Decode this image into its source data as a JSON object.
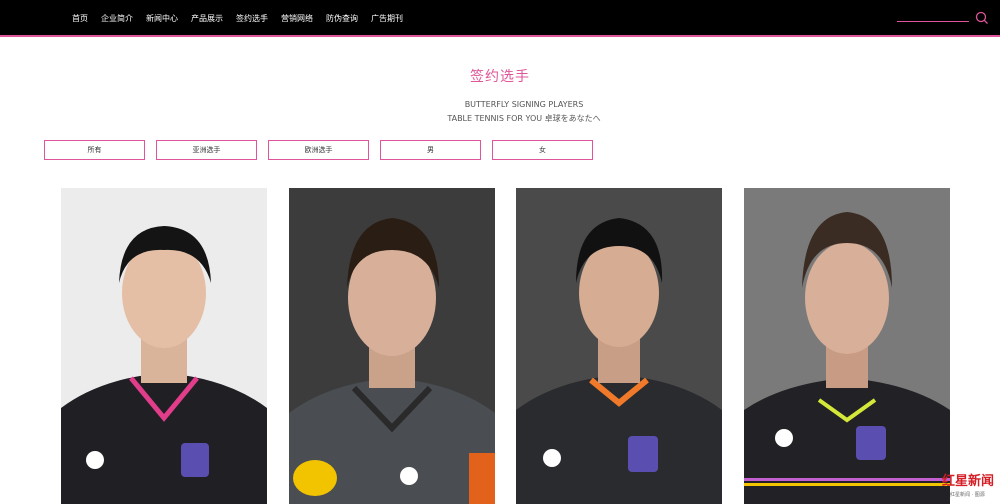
{
  "nav": {
    "items": [
      "首页",
      "企业简介",
      "新闻中心",
      "产品展示",
      "签约选手",
      "营销网络",
      "防伪查询",
      "广告期刊"
    ]
  },
  "search": {
    "icon": "search-icon"
  },
  "heading": {
    "title": "签约选手",
    "subtitle_line1": "BUTTERFLY SIGNING PLAYERS",
    "subtitle_line2": "TABLE TENNIS FOR YOU 卓球をあなたへ"
  },
  "filters": [
    "所有",
    "亚洲选手",
    "欧洲选手",
    "男",
    "女"
  ],
  "players": [
    {
      "photo": "player-photo-1",
      "background": "#ececec",
      "accent": "#e23d8b"
    },
    {
      "photo": "player-photo-2",
      "background": "#3c3c3c",
      "accent": "#f2c400"
    },
    {
      "photo": "player-photo-3",
      "background": "#4a4a4a",
      "accent": "#f07a2a"
    },
    {
      "photo": "player-photo-4",
      "background": "#7a7a7a",
      "accent": "#d4e83a"
    }
  ],
  "watermark": {
    "text": "红星新闻",
    "small": "红星新闻 · 图源"
  },
  "colors": {
    "brand_pink": "#e0559a",
    "topbar": "#000000"
  }
}
